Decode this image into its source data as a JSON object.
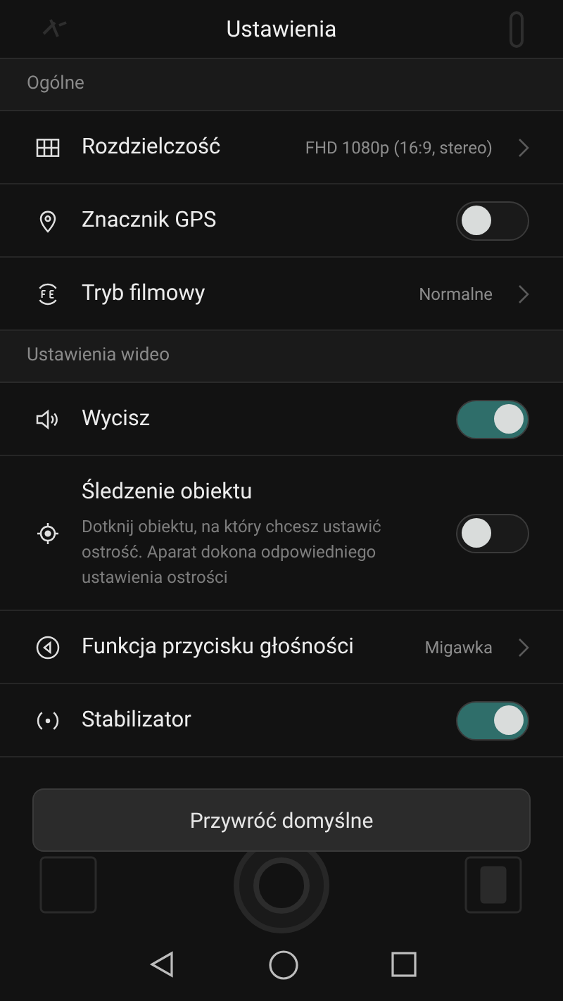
{
  "header": {
    "title": "Ustawienia"
  },
  "sections": [
    {
      "title": "Ogólne",
      "rows": [
        {
          "kind": "value",
          "label": "Rozdzielczość",
          "value": "FHD 1080p (16:9, stereo)"
        },
        {
          "kind": "toggle",
          "label": "Znacznik GPS",
          "on": false
        },
        {
          "kind": "value",
          "label": "Tryb filmowy",
          "value": "Normalne"
        }
      ]
    },
    {
      "title": "Ustawienia wideo",
      "rows": [
        {
          "kind": "toggle",
          "label": "Wycisz",
          "on": true
        },
        {
          "kind": "toggle",
          "label": "Śledzenie obiektu",
          "description": "Dotknij obiektu, na który chcesz ustawić ostrość. Aparat dokona odpowiedniego ustawienia ostrości",
          "on": false
        },
        {
          "kind": "value",
          "label": "Funkcja przycisku głośności",
          "value": "Migawka"
        },
        {
          "kind": "toggle",
          "label": "Stabilizator",
          "on": true
        }
      ]
    }
  ],
  "reset_button": "Przywróć domyślne"
}
